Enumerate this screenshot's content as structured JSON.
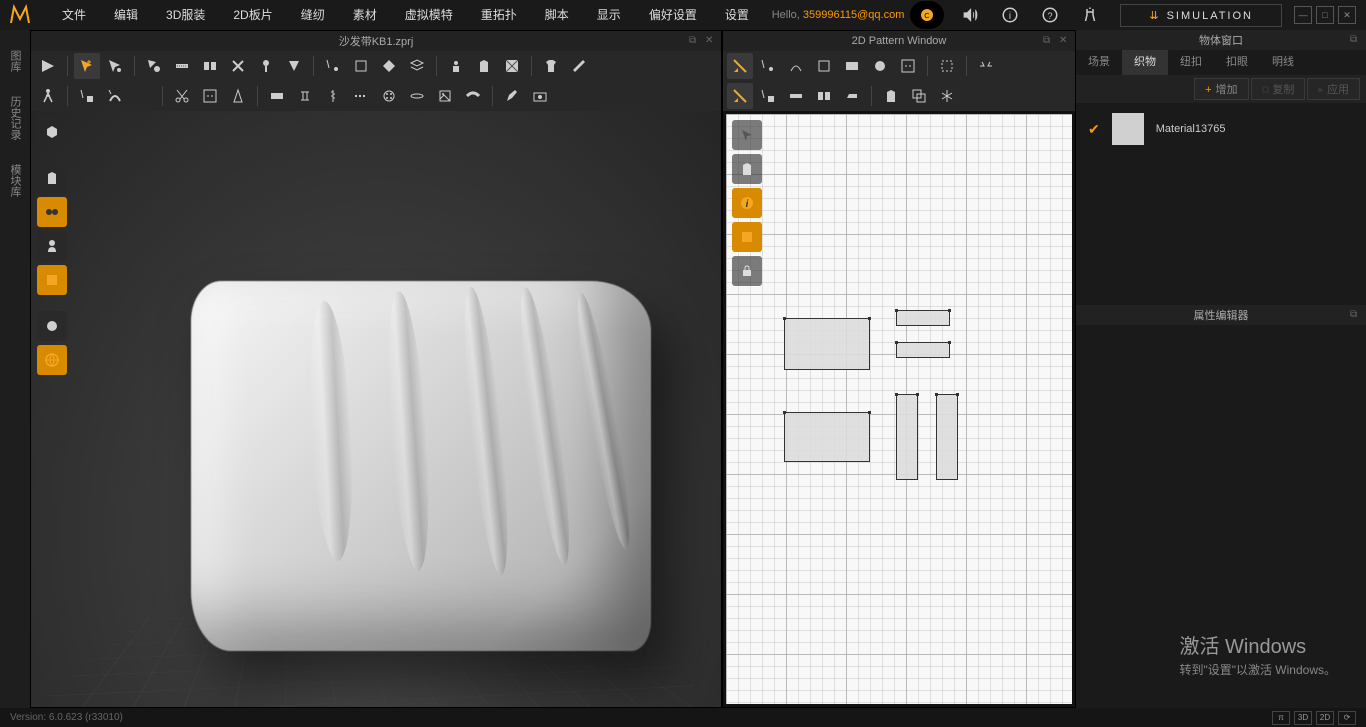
{
  "menu": {
    "items": [
      "文件",
      "编辑",
      "3D服装",
      "2D板片",
      "缝纫",
      "素材",
      "虚拟模特",
      "重拓扑",
      "脚本",
      "显示",
      "偏好设置",
      "设置"
    ]
  },
  "header": {
    "hello_prefix": "Hello, ",
    "user": "359996115@qq.com",
    "simulation_label": "SIMULATION"
  },
  "panel3d": {
    "title": "沙发带KB1.zprj"
  },
  "panel2d": {
    "title": "2D Pattern Window"
  },
  "right_panel": {
    "object_title": "物体窗口",
    "tabs": [
      "场景",
      "织物",
      "纽扣",
      "扣眼",
      "明线"
    ],
    "active_tab": 1,
    "add_label": "增加",
    "copy_label": "复制",
    "apply_label": "应用",
    "material_name": "Material13765",
    "prop_title": "属性编辑器"
  },
  "status": {
    "version": "Version: 6.0.623 (r33010)",
    "btns": [
      "π",
      "3D",
      "2D",
      "⟳"
    ]
  },
  "left_sidebar": {
    "labels": [
      "图库",
      "历史记录",
      "模块库"
    ]
  },
  "watermark": {
    "line1": "激活 Windows",
    "line2": "转到\"设置\"以激活 Windows。"
  },
  "icons": {
    "logo_color": "#f5a623",
    "cloud": "☁",
    "sound": "🔊",
    "info": "ℹ",
    "help": "?",
    "chevrons": "⌄"
  }
}
